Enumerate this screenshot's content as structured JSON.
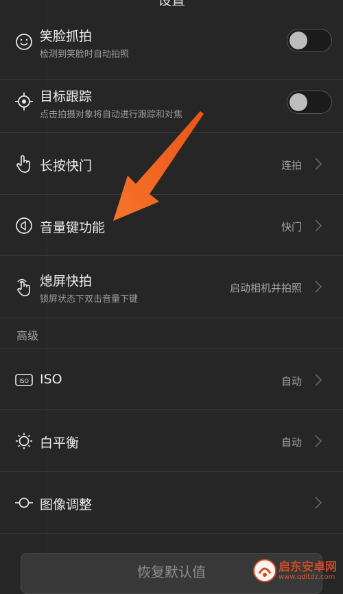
{
  "header": {
    "title": "设置"
  },
  "rows": [
    {
      "title": "笑脸抓拍",
      "subtitle": "检测到笑脸时自动拍照",
      "icon": "smile-icon",
      "toggle": false
    },
    {
      "title": "目标跟踪",
      "subtitle": "点击拍摄对象将自动进行跟踪和对焦",
      "icon": "target-icon",
      "toggle": false
    },
    {
      "title": "长按快门",
      "value": "连拍",
      "icon": "hand-tap-icon"
    },
    {
      "title": "音量键功能",
      "value": "快门",
      "icon": "volume-icon"
    },
    {
      "title": "熄屏快拍",
      "subtitle": "锁屏状态下双击音量下键",
      "value": "启动相机并拍照",
      "icon": "double-tap-icon"
    }
  ],
  "advanced": {
    "header": "高级",
    "rows": [
      {
        "title": "ISO",
        "value": "自动",
        "icon": "iso-icon"
      },
      {
        "title": "白平衡",
        "value": "自动",
        "icon": "sun-icon"
      },
      {
        "title": "图像调整",
        "value": "",
        "icon": "adjust-icon"
      }
    ]
  },
  "reset_button": {
    "label": "恢复默认值"
  },
  "watermark": {
    "name": "启东安卓网",
    "url": "www.qdltdz.com"
  },
  "colors": {
    "accent_arrow": "#f36b21",
    "background": "#262626"
  }
}
